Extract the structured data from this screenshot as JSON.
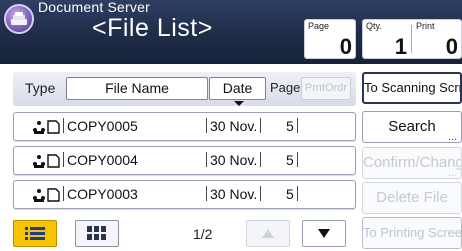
{
  "header": {
    "app_title": "Document Server",
    "screen_title": "<File List>",
    "page_counter": {
      "label": "Page",
      "value": "0"
    },
    "qty_counter": {
      "label": "Qty.",
      "value": "1"
    },
    "print_counter": {
      "label": "Print",
      "value": "0"
    }
  },
  "columns": {
    "type_label": "Type",
    "file_name_label": "File Name",
    "date_label": "Date",
    "page_label": "Page",
    "print_order_label": "PrntOrdr"
  },
  "files": [
    {
      "name": "COPY0005",
      "date": "30 Nov.",
      "pages": "5",
      "icon": "copy-document-icon"
    },
    {
      "name": "COPY0004",
      "date": "30 Nov.",
      "pages": "5",
      "icon": "copy-document-icon"
    },
    {
      "name": "COPY0003",
      "date": "30 Nov.",
      "pages": "5",
      "icon": "copy-document-icon"
    }
  ],
  "pagination": {
    "indicator": "1/2"
  },
  "actions": {
    "to_scanning": "To Scanning Scrn.",
    "search": "Search",
    "confirm_change": "Confirm/Change",
    "delete_file": "Delete File",
    "to_printing": "To Printing Screen"
  },
  "colors": {
    "header_bg": "#1f2c48",
    "active_view": "#f6c400"
  }
}
